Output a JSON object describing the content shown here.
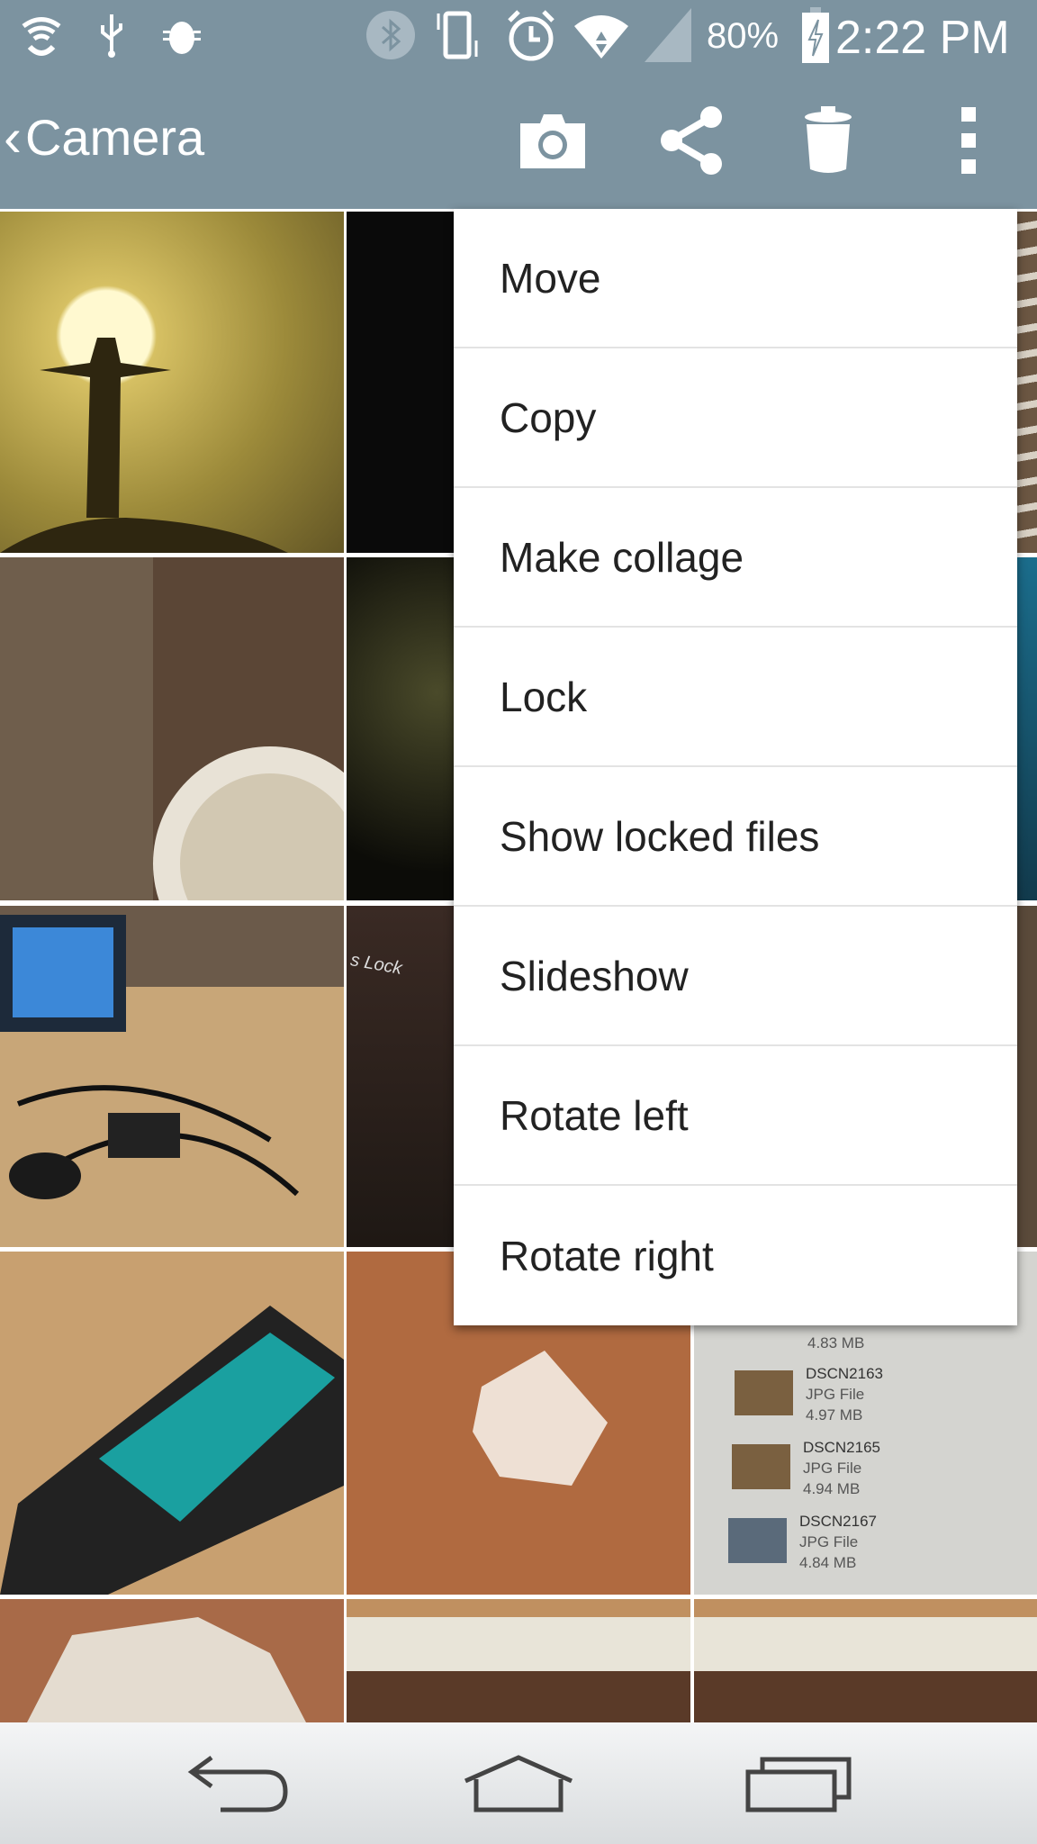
{
  "status_bar": {
    "left_icons": [
      "wifi-call-icon",
      "usb-icon",
      "android-debug-icon"
    ],
    "right_icons": [
      "bluetooth-icon",
      "vibrate-icon",
      "alarm-icon",
      "wifi-icon",
      "signal-icon",
      "battery-charging-icon"
    ],
    "battery": "80%",
    "time": "2:22 PM",
    "color": "#7c93a0"
  },
  "action_bar": {
    "back_label": "Camera",
    "actions": [
      "camera-icon",
      "share-icon",
      "delete-icon",
      "overflow-menu-icon"
    ]
  },
  "menu": {
    "items": [
      "Move",
      "Copy",
      "Make collage",
      "Lock",
      "Show locked files",
      "Slideshow",
      "Rotate left",
      "Rotate right"
    ]
  },
  "thumbnail_text": {
    "partial_size": "4.83 MB",
    "files": [
      {
        "name": "DSCN2163",
        "type": "JPG File",
        "size": "4.97 MB"
      },
      {
        "name": "DSCN2165",
        "type": "JPG File",
        "size": "4.94 MB"
      },
      {
        "name": "DSCN2167",
        "type": "JPG File",
        "size": "4.84 MB"
      }
    ],
    "lock_text": "s Lock"
  },
  "nav_bar": {
    "buttons": [
      "back-icon",
      "home-icon",
      "recents-icon"
    ]
  }
}
